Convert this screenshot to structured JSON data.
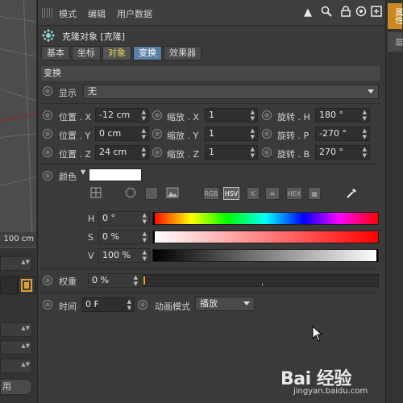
{
  "viewport": {
    "scale_label": "100 cm"
  },
  "left_panel": {
    "apply_label": "用"
  },
  "menubar": {
    "items": [
      "模式",
      "编辑",
      "用户数据"
    ]
  },
  "object": {
    "title": "克隆对象 [克隆]"
  },
  "tabs": [
    {
      "label": "基本",
      "state": "normal"
    },
    {
      "label": "坐标",
      "state": "normal"
    },
    {
      "label": "对象",
      "state": "yellow"
    },
    {
      "label": "变换",
      "state": "selected"
    },
    {
      "label": "效果器",
      "state": "normal"
    }
  ],
  "section": {
    "title": "变换"
  },
  "display": {
    "label": "显示",
    "value": "无"
  },
  "transform": {
    "position": [
      {
        "label": "位置 . X",
        "value": "-12 cm"
      },
      {
        "label": "位置 . Y",
        "value": "0 cm"
      },
      {
        "label": "位置 . Z",
        "value": "24 cm"
      }
    ],
    "scale": [
      {
        "label": "缩放 . X",
        "value": "1"
      },
      {
        "label": "缩放 . Y",
        "value": "1"
      },
      {
        "label": "缩放 . Z",
        "value": "1"
      }
    ],
    "rotation": [
      {
        "label": "旋转 . H",
        "value": "180 °"
      },
      {
        "label": "旋转 . P",
        "value": "-270 °"
      },
      {
        "label": "旋转 . B",
        "value": "270 °"
      }
    ]
  },
  "color": {
    "label": "颜色",
    "swatch": "#ffffff",
    "modes": [
      "RGB",
      "HSV",
      "K",
      "HEX"
    ],
    "active_mode": "HSV",
    "h": {
      "label": "H",
      "value": "0 °",
      "fraction": 0.0
    },
    "s": {
      "label": "S",
      "value": "0 %",
      "fraction": 0.0
    },
    "v": {
      "label": "V",
      "value": "100 %",
      "fraction": 1.0
    }
  },
  "weight": {
    "label": "权重",
    "value": "0 %",
    "fraction": 0.0
  },
  "time": {
    "label": "时间",
    "value": "0 F"
  },
  "anim_mode": {
    "label": "动画模式",
    "value": "播放"
  },
  "watermark": {
    "main": "Bai 经验",
    "sub": "jingyan.baidu.com"
  },
  "right_dock": {
    "tabs": [
      "属性",
      "层"
    ]
  }
}
